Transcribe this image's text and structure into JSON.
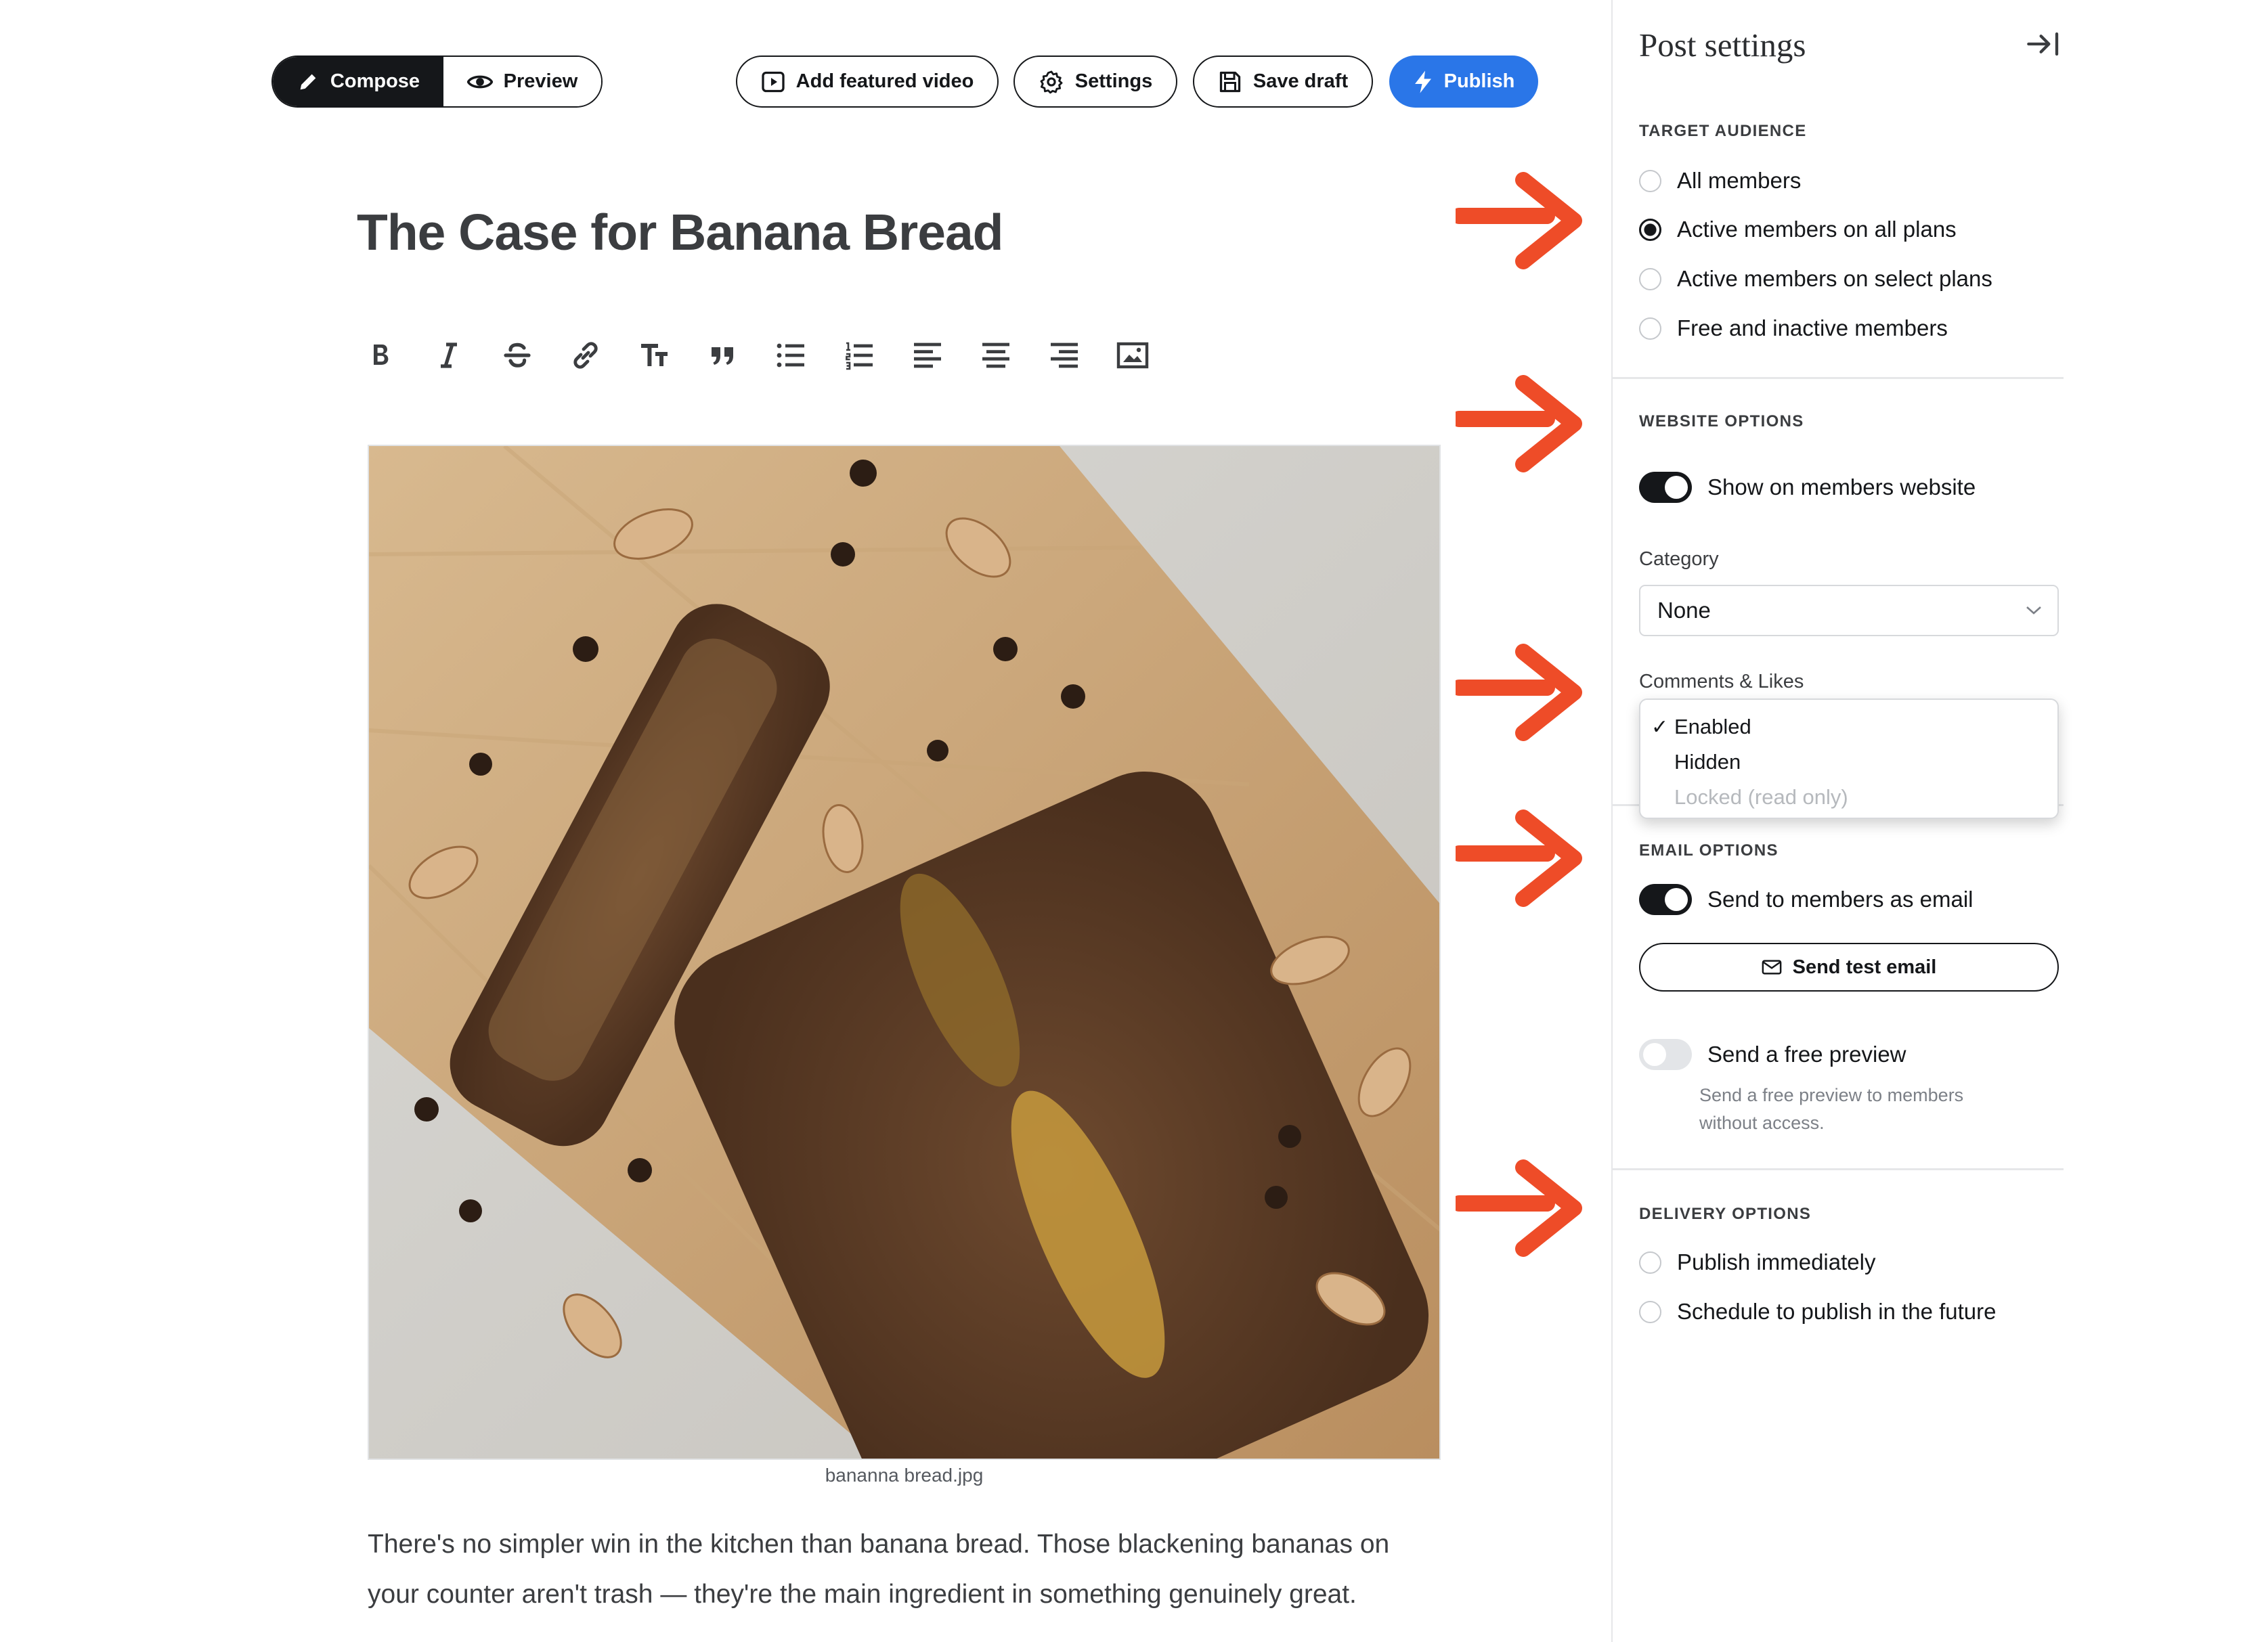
{
  "toolbar": {
    "compose_label": "Compose",
    "preview_label": "Preview",
    "featured_video_label": "Add featured video",
    "settings_label": "Settings",
    "save_draft_label": "Save draft",
    "publish_label": "Publish"
  },
  "editor": {
    "title": "The Case for Banana Bread",
    "format_tools": [
      "bold-icon",
      "italic-icon",
      "strikethrough-icon",
      "link-icon",
      "text-size-icon",
      "quote-icon",
      "bullet-list-icon",
      "numbered-list-icon",
      "align-left-icon",
      "align-center-icon",
      "align-right-icon",
      "image-icon"
    ],
    "image_caption": "bananna bread.jpg",
    "body_text": "There's no simpler win in the kitchen than banana bread. Those blackening bananas on your counter aren't trash — they're the main ingredient in something genuinely great."
  },
  "sidebar": {
    "title": "Post settings",
    "target_audience": {
      "heading": "TARGET AUDIENCE",
      "options": [
        "All members",
        "Active members on all plans",
        "Active members on select plans",
        "Free and inactive members"
      ],
      "selected": "Active members on all plans"
    },
    "website_options": {
      "heading": "WEBSITE OPTIONS",
      "show_on_website_label": "Show on members website",
      "show_on_website_enabled": true,
      "category_label": "Category",
      "category_value": "None",
      "comments_label": "Comments & Likes",
      "comments_options": [
        "Enabled",
        "Hidden",
        "Locked (read only)"
      ],
      "comments_selected": "Enabled",
      "check_mark": "✓"
    },
    "email_options": {
      "heading": "EMAIL OPTIONS",
      "send_email_label": "Send to members as email",
      "send_email_enabled": true,
      "test_email_label": "Send test email",
      "free_preview_label": "Send a free preview",
      "free_preview_enabled": false,
      "free_preview_hint": "Send a free preview to members without access."
    },
    "delivery_options": {
      "heading": "DELIVERY OPTIONS",
      "options": [
        "Publish immediately",
        "Schedule to publish in the future"
      ]
    }
  },
  "colors": {
    "accent_blue": "#2a76e8",
    "annotation_arrow": "#ee4c28",
    "ink": "#15171a"
  }
}
